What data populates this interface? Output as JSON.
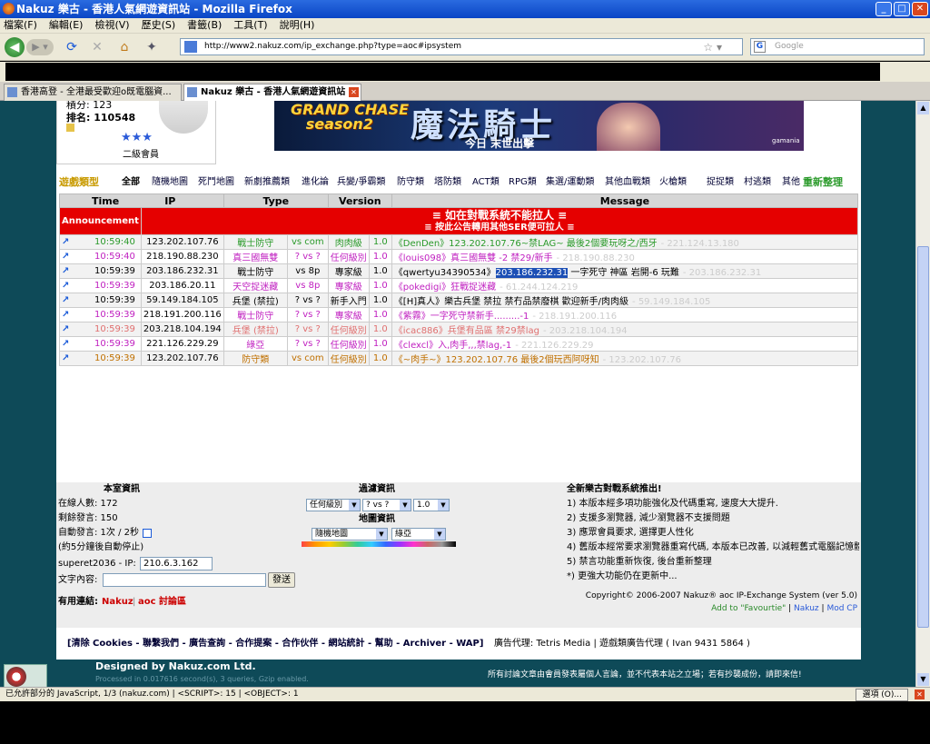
{
  "window": {
    "title": "Nakuz 樂古 - 香港人氣網遊資訊站 - Mozilla Firefox"
  },
  "menu": [
    "檔案(F)",
    "編輯(E)",
    "檢視(V)",
    "歷史(S)",
    "書籤(B)",
    "工具(T)",
    "說明(H)"
  ],
  "nav": {
    "url": "http://www2.nakuz.com/ip_exchange.php?type=aoc#ipsystem",
    "search_placeholder": "Google"
  },
  "tabs": [
    {
      "label": "香港高登 - 全港最受歡迎o既電腦資..."
    },
    {
      "label": "Nakuz 樂古 - 香港人氣網遊資訊站"
    }
  ],
  "user": {
    "top": "積分: 123",
    "rank": "排名: 110548",
    "level": "二級會員",
    "stars": "★★★"
  },
  "banner": {
    "logo": "GRAND CHASE\nseason2",
    "title": "魔法騎士",
    "subtitle": "今日 末世出擊",
    "tag": "gamania"
  },
  "categories": [
    "遊戲類型",
    "全部",
    "隨機地圖",
    "死鬥地圖",
    "新劇推薦類",
    "進化論",
    "兵變/爭霸類",
    "防守類",
    "塔防類",
    "ACT類",
    "RPG類",
    "集選/運動類",
    "其他血戰類",
    "火槍類",
    "捉捉類",
    "村逃類",
    "其他",
    "重新整理"
  ],
  "table": {
    "headers": [
      "Time",
      "IP",
      "Type",
      "Version",
      "Message"
    ],
    "announcement_label": "Announcement",
    "announcement_line1": "≡ 如在對戰系統不能拉人 ≡",
    "announcement_line2": "≡ 按此公告轉用其他SER便可拉人 ≡",
    "rows": [
      {
        "time": "10:59:40",
        "ip": "123.202.107.76",
        "type": "戰士防守",
        "vs": "vs com",
        "level": "肉肉級",
        "ver": "1.0",
        "msg": "《DenDen》123.202.107.76~禁LAG~ 最後2個要玩呀之/西牙",
        "trail": "- 221.124.13.180",
        "color": "#2a9a2a"
      },
      {
        "time": "10:59:40",
        "ip": "218.190.88.230",
        "type": "真三國無雙",
        "vs": "? vs ?",
        "level": "任何級別",
        "ver": "1.0",
        "msg": "《louis098》真三國無雙 -2 禁29/新手",
        "trail": "- 218.190.88.230",
        "color": "#c020c0"
      },
      {
        "time": "10:59:39",
        "ip": "203.186.232.31",
        "type": "戰士防守",
        "vs": "vs 8p",
        "level": "專家級",
        "ver": "1.0",
        "msg": "《qwertyu34390534》",
        "highlight": "203.186.232.31",
        "msg2": " 一字死守 神區 岩開-6 玩難",
        "trail": "- 203.186.232.31",
        "color": "#000000"
      },
      {
        "time": "10:59:39",
        "ip": "203.186.20.11",
        "type": "天空捉迷藏",
        "vs": "vs 8p",
        "level": "專家級",
        "ver": "1.0",
        "msg": "《pokedigi》狂戰捉迷藏",
        "trail": "- 61.244.124.219",
        "color": "#c020c0"
      },
      {
        "time": "10:59:39",
        "ip": "59.149.184.105",
        "type": "兵堡 (禁拉)",
        "vs": "? vs ?",
        "level": "新手入門",
        "ver": "1.0",
        "msg": "《[H]真人》樂古兵堡 禁拉 禁冇品禁廢棋 歡迎新手/肉肉級",
        "trail": "- 59.149.184.105",
        "color": "#000000"
      },
      {
        "time": "10:59:39",
        "ip": "218.191.200.116",
        "type": "戰士防守",
        "vs": "? vs ?",
        "level": "專家級",
        "ver": "1.0",
        "msg": "《紫霧》一字死守禁新手.........-1",
        "trail": "- 218.191.200.116",
        "color": "#c020c0"
      },
      {
        "time": "10:59:39",
        "ip": "203.218.104.194",
        "type": "兵堡 (禁拉)",
        "vs": "? vs ?",
        "level": "任何級別",
        "ver": "1.0",
        "msg": "《icac886》兵堡有品區 禁29禁lag",
        "trail": "- 203.218.104.194",
        "color": "#e07070"
      },
      {
        "time": "10:59:39",
        "ip": "221.126.229.29",
        "type": "綠亞",
        "vs": "? vs ?",
        "level": "任何級別",
        "ver": "1.0",
        "msg": "《clexcl》入,肉手,,,禁lag,-1",
        "trail": "- 221.126.229.29",
        "color": "#c020c0"
      },
      {
        "time": "10:59:39",
        "ip": "123.202.107.76",
        "type": "防守類",
        "vs": "vs com",
        "level": "任何級別",
        "ver": "1.0",
        "msg": "《~肉手~》123.202.107.76 最後2個玩西阿呀知",
        "trail": "- 123.202.107.76",
        "color": "#c07000"
      }
    ]
  },
  "room": {
    "title": "本室資訊",
    "online": "在線人數: 172",
    "left": "剩餘發言: 150",
    "auto": "自動發言: 1次 / 2秒",
    "auto_note": "(約5分鐘後自動停止)",
    "user_ip": "superet2036 - IP:",
    "ip_value": "210.6.3.162",
    "content_label": "文字內容:",
    "send": "發送",
    "links_label": "有用連結:",
    "link1": "Nakuz",
    "link2": "aoc 討論區"
  },
  "filter": {
    "title": "過濾資訊",
    "level": "任何級別",
    "vs": "? vs ?",
    "ver": "1.0",
    "map_title": "地圖資訊",
    "map1": "隨機地圖",
    "map2": "綠亞"
  },
  "news": {
    "title": "全新樂古對戰系統推出!",
    "items": [
      "1) 本版本經多項功能強化及代碼重寫, 速度大大提升.",
      "2) 支援多瀏覽器, 減少瀏覽器不支援問題",
      "3) 應眾會員要求, 選擇更人性化",
      "4) 舊版本經常要求瀏覽器重寫代碼, 本版本已改善, 以減輕舊式電腦記憶體不",
      "5) 禁言功能重新恢復, 後台重新整理",
      "*) 更強大功能仍在更新中..."
    ],
    "copyright": "Copyright© 2006-2007  Nakuz® aoc IP-Exchange System (ver 5.0)",
    "fav": "Add to \"Favourtie\"",
    "nakuz": "Nakuz",
    "modcp": "Mod CP"
  },
  "footer": {
    "links": "[清除 Cookies - 聯繫我們 - 廣告查詢 - 合作提案 - 合作伙伴 - 網站統計 - 幫助 - Archiver - WAP]",
    "agent": "廣告代理: Tetris Media | 遊戲類廣告代理 ( Ivan 9431 5864 )",
    "designed": "Designed by Nakuz.com Ltd.",
    "processed": "Processed in 0.017616 second(s), 3 queries, Gzip enabled.",
    "disclaimer": "所有討論文章由會員發表屬個人言論，並不代表本站之立場；若有抄襲成份，請即來信!"
  },
  "status": {
    "text": "已允許部分的 JavaScript, 1/3 (nakuz.com) | <SCRIPT>: 15 | <OBJECT>: 1",
    "options": "選項 (O)..."
  },
  "colors": {
    "announce": "#e50000",
    "page_bg": "#0e4a58"
  }
}
